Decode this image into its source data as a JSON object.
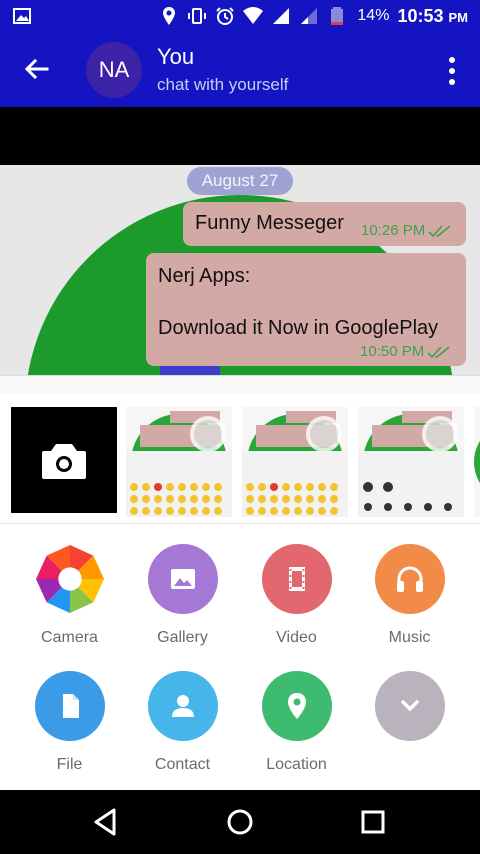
{
  "status_bar": {
    "battery_percent": "14%",
    "time": "10:53",
    "am_pm": "PM"
  },
  "header": {
    "avatar_initials": "NA",
    "title": "You",
    "subtitle": "chat with yourself"
  },
  "chat": {
    "date_label": "August 27",
    "messages": [
      {
        "lines": [
          "Funny Messeger"
        ],
        "time": "10:26 PM",
        "status": "read"
      },
      {
        "lines": [
          "Nerj Apps:",
          "Download it Now in GooglePlay"
        ],
        "time": "10:50 PM",
        "status": "read"
      }
    ]
  },
  "attach": {
    "options": [
      {
        "label": "Camera",
        "icon": "aperture-icon",
        "color": "#multicolor"
      },
      {
        "label": "Gallery",
        "icon": "image-icon",
        "color": "#a678d6"
      },
      {
        "label": "Video",
        "icon": "film-icon",
        "color": "#e2676e"
      },
      {
        "label": "Music",
        "icon": "headphones-icon",
        "color": "#f28a48"
      },
      {
        "label": "File",
        "icon": "file-icon",
        "color": "#3c9be6"
      },
      {
        "label": "Contact",
        "icon": "person-icon",
        "color": "#45b5ea"
      },
      {
        "label": "Location",
        "icon": "location-pin-icon",
        "color": "#3dbb70"
      },
      {
        "label": "",
        "icon": "chevron-down-icon",
        "color": "#b8b3bd"
      }
    ]
  },
  "colors": {
    "primary": "#1414c2",
    "bubble": "#d3a9a6",
    "time_green": "#3fa14a"
  }
}
